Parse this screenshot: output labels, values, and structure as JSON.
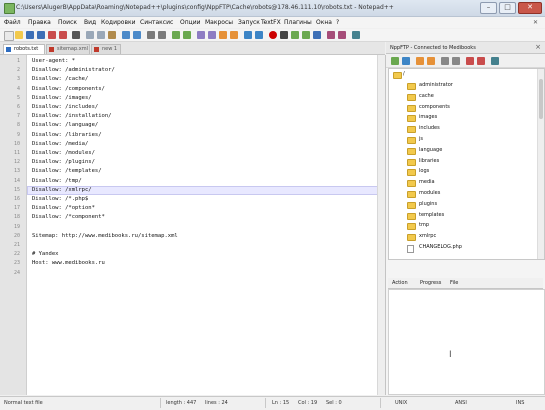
{
  "window": {
    "title": "C:\\Users\\AlugerB\\AppData\\Roaming\\Notepad++\\plugins\\config\\NppFTP\\Cache\\robots@178.46.111.10\\robots.txt - Notepad++"
  },
  "menu": [
    "Файл",
    "Правка",
    "Поиск",
    "Вид",
    "Кодировки",
    "Синтаксис",
    "Опции",
    "Макросы",
    "Запуск",
    "TextFX",
    "Плагины",
    "Окна",
    "?"
  ],
  "tabs": [
    {
      "label": "robots.txt",
      "active": true
    },
    {
      "label": "sitemap.xml",
      "active": false
    },
    {
      "label": "new 1",
      "active": false
    }
  ],
  "editor": {
    "lines": [
      "User-agent: *",
      "Disallow: /administrator/",
      "Disallow: /cache/",
      "Disallow: /components/",
      "Disallow: /images/",
      "Disallow: /includes/",
      "Disallow: /installation/",
      "Disallow: /language/",
      "Disallow: /libraries/",
      "Disallow: /media/",
      "Disallow: /modules/",
      "Disallow: /plugins/",
      "Disallow: /templates/",
      "Disallow: /tmp/",
      "Disallow: /xmlrpc/",
      "Disallow: /*.php$",
      "Disallow: /*option*",
      "Disallow: /*component*",
      "",
      "Sitemap: http://www.medibooks.ru/sitemap.xml",
      "",
      "# Yandex",
      "Host: www.medibooks.ru",
      ""
    ],
    "current_line": 15
  },
  "ftp": {
    "header": "NppFTP - Connected to Medibooks",
    "root": "/",
    "items": [
      {
        "name": "administrator",
        "type": "folder"
      },
      {
        "name": "cache",
        "type": "folder"
      },
      {
        "name": "components",
        "type": "folder"
      },
      {
        "name": "images",
        "type": "folder"
      },
      {
        "name": "includes",
        "type": "folder"
      },
      {
        "name": "js",
        "type": "folder"
      },
      {
        "name": "language",
        "type": "folder"
      },
      {
        "name": "libraries",
        "type": "folder"
      },
      {
        "name": "logs",
        "type": "folder"
      },
      {
        "name": "media",
        "type": "folder"
      },
      {
        "name": "modules",
        "type": "folder"
      },
      {
        "name": "plugins",
        "type": "folder"
      },
      {
        "name": "templates",
        "type": "folder"
      },
      {
        "name": "tmp",
        "type": "folder"
      },
      {
        "name": "xmlrpc",
        "type": "folder"
      },
      {
        "name": "CHANGELOG.php",
        "type": "file"
      }
    ],
    "queue_columns": [
      "Action",
      "Progress",
      "File"
    ]
  },
  "status": {
    "type": "Normal text file",
    "length": "length : 447",
    "lines": "lines : 24",
    "ln": "Ln : 15",
    "col": "Col : 19",
    "sel": "Sel : 0",
    "eol": "UNIX",
    "encoding": "ANSI",
    "mode": "INS"
  },
  "colors": {
    "current_line": "#e8e8ff",
    "folder": "#f2c94c"
  }
}
